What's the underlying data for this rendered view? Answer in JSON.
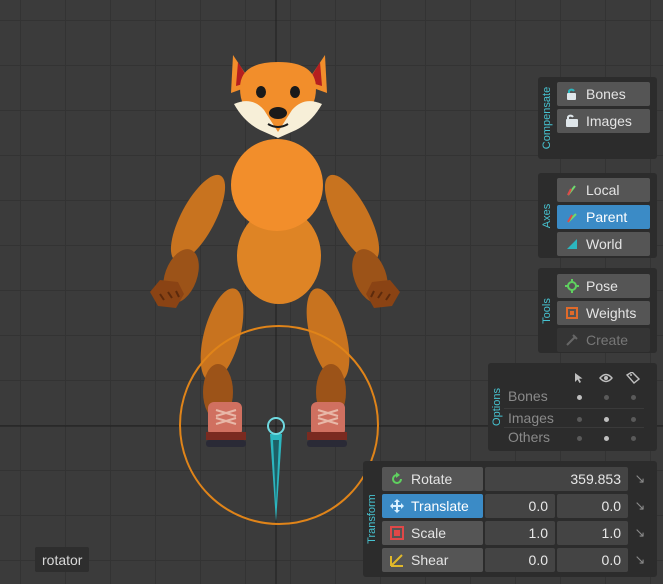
{
  "compensate": {
    "title": "Compensate",
    "bones_label": "Bones",
    "images_label": "Images"
  },
  "axes": {
    "title": "Axes",
    "local_label": "Local",
    "parent_label": "Parent",
    "world_label": "World",
    "selected": "Parent"
  },
  "tools": {
    "title": "Tools",
    "pose_label": "Pose",
    "weights_label": "Weights",
    "create_label": "Create"
  },
  "options": {
    "title": "Options",
    "columns": [
      "select-icon",
      "eye-icon",
      "tag-icon"
    ],
    "rows": [
      {
        "label": "Bones",
        "flags": [
          true,
          false,
          false
        ]
      },
      {
        "label": "Images",
        "flags": [
          false,
          true,
          false
        ]
      },
      {
        "label": "Others",
        "flags": [
          false,
          true,
          false
        ]
      }
    ]
  },
  "transform": {
    "title": "Transform",
    "rotate": {
      "label": "Rotate",
      "value": "359.853"
    },
    "translate": {
      "label": "Translate",
      "x": "0.0",
      "y": "0.0"
    },
    "scale": {
      "label": "Scale",
      "x": "1.0",
      "y": "1.0"
    },
    "shear": {
      "label": "Shear",
      "x": "0.0",
      "y": "0.0"
    },
    "selected": "Translate"
  },
  "status": {
    "selection_name": "rotator"
  },
  "colors": {
    "accent": "#3b8bc6",
    "panel_label": "#47c3d1",
    "fox_orange": "#f28e2b",
    "fox_dark": "#c8731f",
    "selection_circle": "#e08419",
    "rotator_bone": "#2cb6bf"
  }
}
